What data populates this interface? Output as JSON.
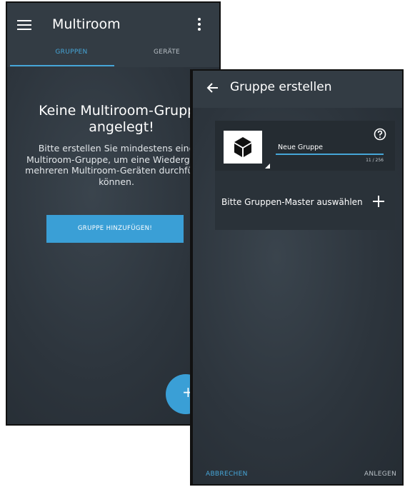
{
  "screen1": {
    "app_title": "Multiroom",
    "tabs": [
      {
        "label": "GRUPPEN",
        "active": true
      },
      {
        "label": "GERÄTE",
        "active": false
      }
    ],
    "empty_title_line1": "Keine Multiroom-Gruppe",
    "empty_title_line2": "angelegt!",
    "empty_desc_line1": "Bitte erstellen Sie mindestens eine",
    "empty_desc_line2": "Multiroom-Gruppe, um eine Wiedergabe",
    "empty_desc_line3": "mehreren Multiroom-Geräten durchführe",
    "empty_desc_line4": "können.",
    "add_group_button": "GRUPPE HINZUFÜGEN!",
    "fab_label": "+"
  },
  "screen2": {
    "title": "Gruppe erstellen",
    "group_name_value": "Neue Gruppe",
    "char_counter": "11 / 256",
    "master_prompt": "Bitte Gruppen-Master auswählen",
    "cancel_button": "ABBRECHEN",
    "create_button": "ANLEGEN"
  },
  "icons": {
    "menu": "hamburger-menu-icon",
    "overflow": "more-vertical-icon",
    "back": "arrow-left-icon",
    "help": "help-circle-icon",
    "add": "plus-icon",
    "group_image": "cube-icon"
  },
  "colors": {
    "accent": "#3a9fd6",
    "appbar": "#333c44",
    "background": "#2d353d"
  }
}
